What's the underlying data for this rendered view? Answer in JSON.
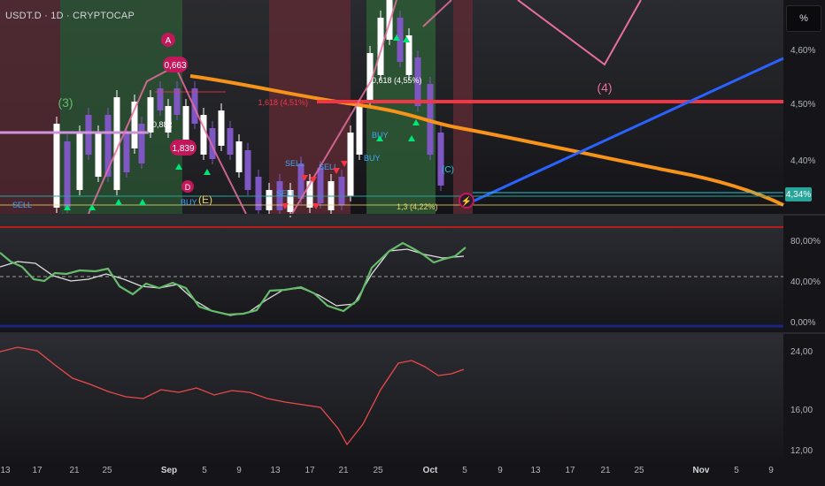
{
  "header": {
    "title": "USDT.D · 1D · CRYPTOCAP",
    "scale_button": "%"
  },
  "price_axis": {
    "labels": [
      "4,60%",
      "4,50%",
      "4,40%"
    ],
    "current_price": "4,34%",
    "current_price_color": "#26a69a"
  },
  "rsi_axis": {
    "labels": [
      "80,00%",
      "40,00%",
      "0,00%"
    ]
  },
  "indicator_axis": {
    "labels": [
      "24,00",
      "16,00",
      "12,00"
    ]
  },
  "time_axis": {
    "labels": [
      {
        "text": "13",
        "month": false
      },
      {
        "text": "17",
        "month": false
      },
      {
        "text": "21",
        "month": false
      },
      {
        "text": "25",
        "month": false
      },
      {
        "text": "Sep",
        "month": true
      },
      {
        "text": "5",
        "month": false
      },
      {
        "text": "9",
        "month": false
      },
      {
        "text": "13",
        "month": false
      },
      {
        "text": "17",
        "month": false
      },
      {
        "text": "21",
        "month": false
      },
      {
        "text": "25",
        "month": false
      },
      {
        "text": "Oct",
        "month": true
      },
      {
        "text": "5",
        "month": false
      },
      {
        "text": "9",
        "month": false
      },
      {
        "text": "13",
        "month": false
      },
      {
        "text": "17",
        "month": false
      },
      {
        "text": "21",
        "month": false
      },
      {
        "text": "25",
        "month": false
      },
      {
        "text": "Nov",
        "month": true
      },
      {
        "text": "5",
        "month": false
      },
      {
        "text": "9",
        "month": false
      }
    ]
  },
  "annotations": {
    "wave_3": "(3)",
    "wave_4": "(4)",
    "fib_level": "1,618 (4,51%)",
    "fib_level_2": "0,618 (4,55%)",
    "fib_level_3": "0,882",
    "fib_level_4": "1,3 (4,22%)",
    "label_A": "A",
    "label_D": "D",
    "label_1839": "1,839",
    "label_0663": "0,663",
    "buy": "BUY",
    "sell": "SELL",
    "wave_c": "(C)",
    "wave_e": "(E)"
  },
  "colors": {
    "fib_line": "#f23645",
    "ema_orange": "#f7931a",
    "trend_blue": "#2962ff",
    "zigzag_pink": "#e66fa0",
    "rsi_line": "#ffffff",
    "indicator_red": "#e84a4a",
    "bull_candle": "#ffffff",
    "bear_candle": "#7e57c2",
    "bg_green": "#2e5a36",
    "bg_red": "#5a2a33"
  }
}
